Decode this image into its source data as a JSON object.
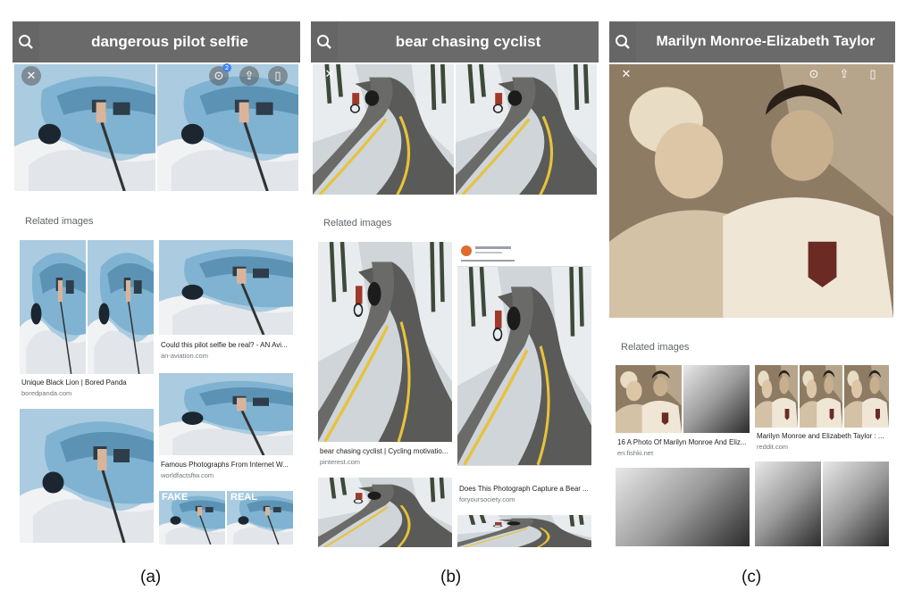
{
  "panels": [
    {
      "label": "(a)",
      "query": "dangerous pilot selfie",
      "related_heading": "Related images",
      "results": [
        {
          "caption": "Unique Black Lion | Bored Panda",
          "source": "boredpanda.com"
        },
        {
          "caption": "Could this pilot selfie be real? - AN Avi...",
          "source": "an-aviation.com"
        },
        {
          "caption": "Famous Photographs From Internet W...",
          "source": "worldfactsftw.com"
        }
      ],
      "fake_label": "FAKE",
      "real_label": "REAL",
      "badge": "2"
    },
    {
      "label": "(b)",
      "query": "bear chasing cyclist",
      "related_heading": "Related images",
      "results": [
        {
          "caption": "bear chasing cyclist | Cycling motivatio...",
          "source": "pinterest.com"
        },
        {
          "caption": "Does This Photograph Capture a Bear ...",
          "source": "foryoursociety.com"
        }
      ]
    },
    {
      "label": "(c)",
      "query": "Marilyn Monroe-Elizabeth Taylor",
      "related_heading": "Related images",
      "results": [
        {
          "caption": "16 A Photo Of Marilyn Monroe And Eliz...",
          "source": "en.fishki.net"
        },
        {
          "caption": "Marilyn Monroe and Elizabeth Taylor : ...",
          "source": "reddit.com"
        }
      ]
    }
  ],
  "icons": {
    "search": "search-icon",
    "close": "close-icon",
    "lens": "lens-icon",
    "share": "share-icon",
    "bookmark": "bookmark-icon"
  },
  "colors": {
    "searchbar_bg": "#6e6e6e",
    "query_text": "#ffffff",
    "related_text": "#5f6368",
    "source_text": "#70757a"
  }
}
